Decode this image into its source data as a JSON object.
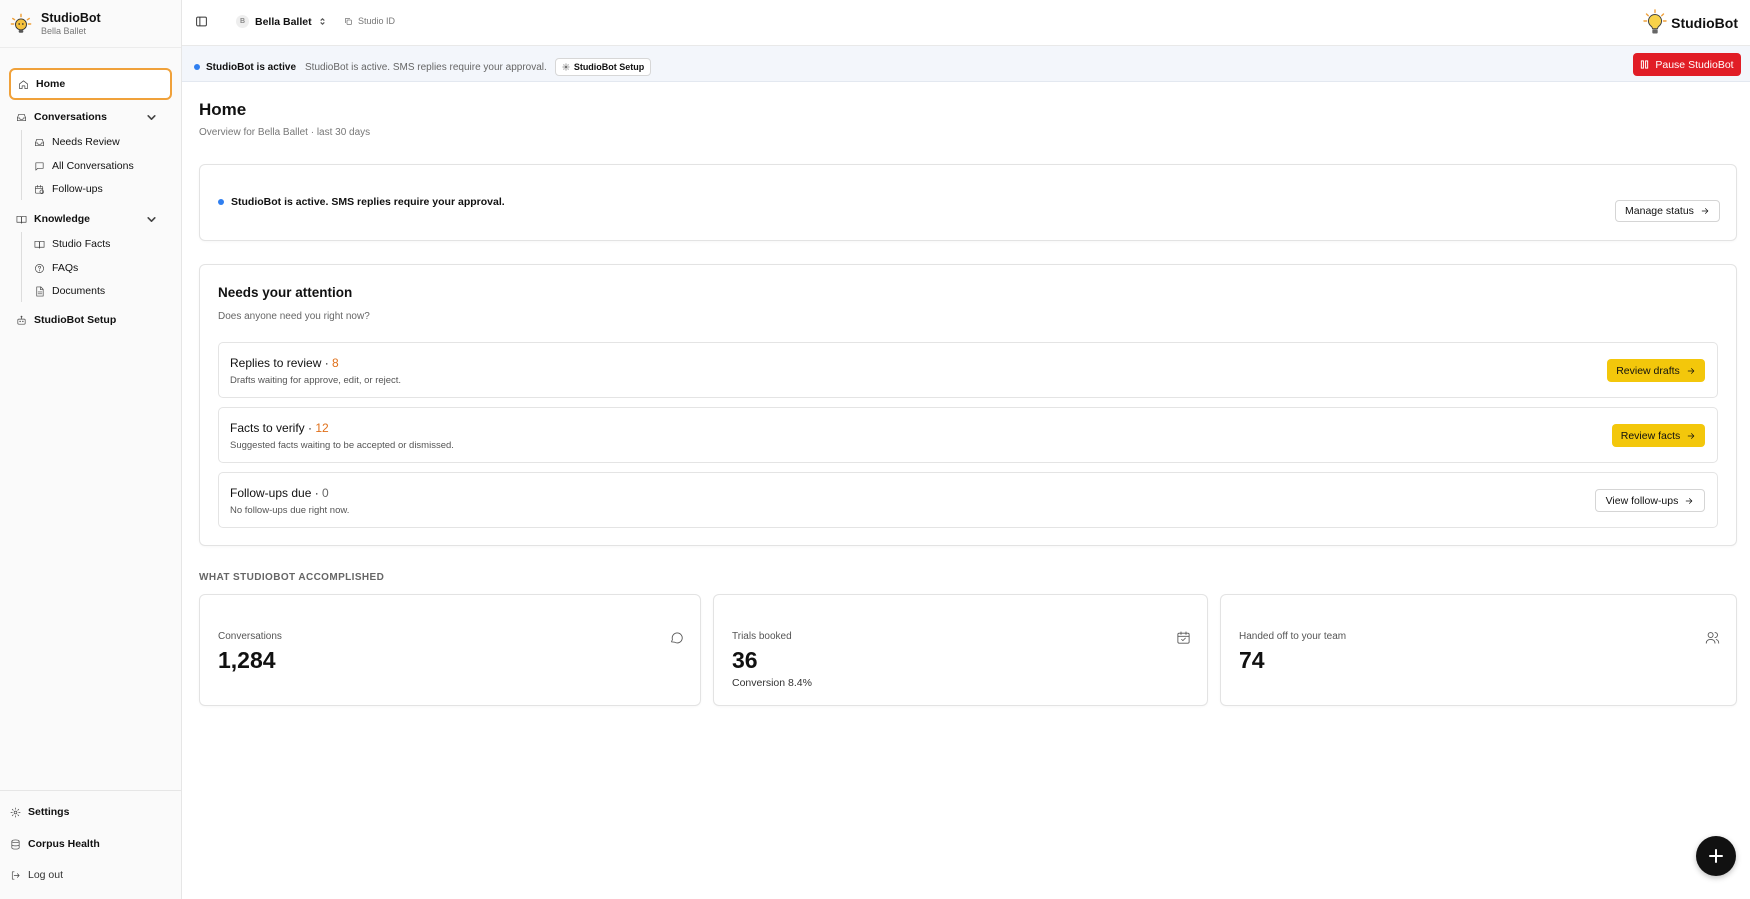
{
  "brand": {
    "name": "StudioBot",
    "studio": "Bella Ballet"
  },
  "sidebar": {
    "home": "Home",
    "conversations": {
      "label": "Conversations",
      "items": [
        "Needs Review",
        "All Conversations",
        "Follow-ups"
      ]
    },
    "knowledge": {
      "label": "Knowledge",
      "items": [
        "Studio Facts",
        "FAQs",
        "Documents"
      ]
    },
    "setup": "StudioBot Setup",
    "footer": [
      "Settings",
      "Corpus Health",
      "Log out"
    ]
  },
  "topbar": {
    "workspace_initial": "B",
    "workspace": "Bella Ballet",
    "studio_id": "Studio ID",
    "logo_text": "StudioBot"
  },
  "banner": {
    "status_title": "StudioBot is active",
    "status_desc": "StudioBot is active. SMS replies require your approval.",
    "setup_button": "StudioBot Setup",
    "pause_button": "Pause StudioBot"
  },
  "page": {
    "title": "Home",
    "subtitle": "Overview for Bella Ballet · last 30 days"
  },
  "status_card": {
    "text": "StudioBot is active. SMS replies require your approval.",
    "button": "Manage status"
  },
  "attention": {
    "title": "Needs your attention",
    "subtitle": "Does anyone need you right now?",
    "rows": [
      {
        "title": "Replies to review · ",
        "count": "8",
        "desc": "Drafts waiting for approve, edit, or reject.",
        "button": "Review drafts"
      },
      {
        "title": "Facts to verify · ",
        "count": "12",
        "desc": "Suggested facts waiting to be accepted or dismissed.",
        "button": "Review facts"
      },
      {
        "title": "Follow-ups due · ",
        "count": "0",
        "desc": "No follow-ups due right now.",
        "button": "View follow-ups"
      }
    ]
  },
  "accomplished": {
    "label": "WHAT STUDIOBOT ACCOMPLISHED",
    "stats": [
      {
        "label": "Conversations",
        "value": "1,284",
        "icon": "chat-bubble-icon"
      },
      {
        "label": "Trials booked",
        "value": "36",
        "extra": "Conversion 8.4%",
        "icon": "calendar-check-icon"
      },
      {
        "label": "Handed off to your team",
        "value": "74",
        "icon": "users-icon"
      }
    ]
  },
  "colors": {
    "accent_orange": "#f0a13a",
    "pause_red": "#e11d26",
    "review_yellow": "#f3c70b",
    "status_blue": "#2f7ff0",
    "count_orange": "#e0701a"
  }
}
